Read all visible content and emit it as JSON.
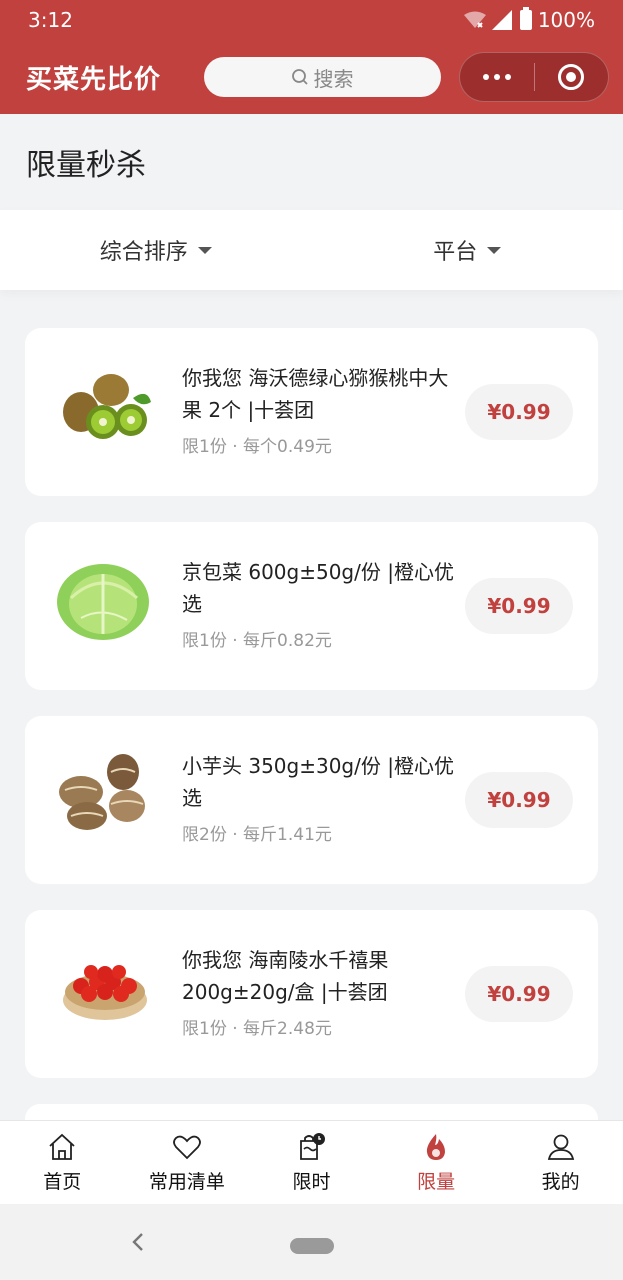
{
  "status": {
    "time": "3:12",
    "battery": "100%"
  },
  "navbar": {
    "title": "买菜先比价",
    "search_placeholder": "搜索"
  },
  "page": {
    "title": "限量秒杀"
  },
  "filters": [
    {
      "label": "综合排序"
    },
    {
      "label": "平台"
    }
  ],
  "products": [
    {
      "name": "你我您 海沃德绿心猕猴桃中大果 2个 |十荟团",
      "limit": "限1份",
      "unit_price": "每个0.49元",
      "price": "¥0.99",
      "image": "kiwi"
    },
    {
      "name": "京包菜 600g±50g/份 |橙心优选",
      "limit": "限1份",
      "unit_price": "每斤0.82元",
      "price": "¥0.99",
      "image": "cabbage"
    },
    {
      "name": "小芋头 350g±30g/份 |橙心优选",
      "limit": "限2份",
      "unit_price": "每斤1.41元",
      "price": "¥0.99",
      "image": "taro"
    },
    {
      "name": "你我您 海南陵水千禧果200g±20g/盒 |十荟团",
      "limit": "限1份",
      "unit_price": "每斤2.48元",
      "price": "¥0.99",
      "image": "cherry-tomato"
    }
  ],
  "separator": "·",
  "tabs": [
    {
      "label": "首页",
      "icon": "home-icon"
    },
    {
      "label": "常用清单",
      "icon": "heart-icon"
    },
    {
      "label": "限时",
      "icon": "timer-bag-icon"
    },
    {
      "label": "限量",
      "icon": "flame-icon",
      "active": true
    },
    {
      "label": "我的",
      "icon": "user-icon"
    }
  ],
  "colors": {
    "brand": "#c0413e",
    "price": "#c0413e"
  }
}
